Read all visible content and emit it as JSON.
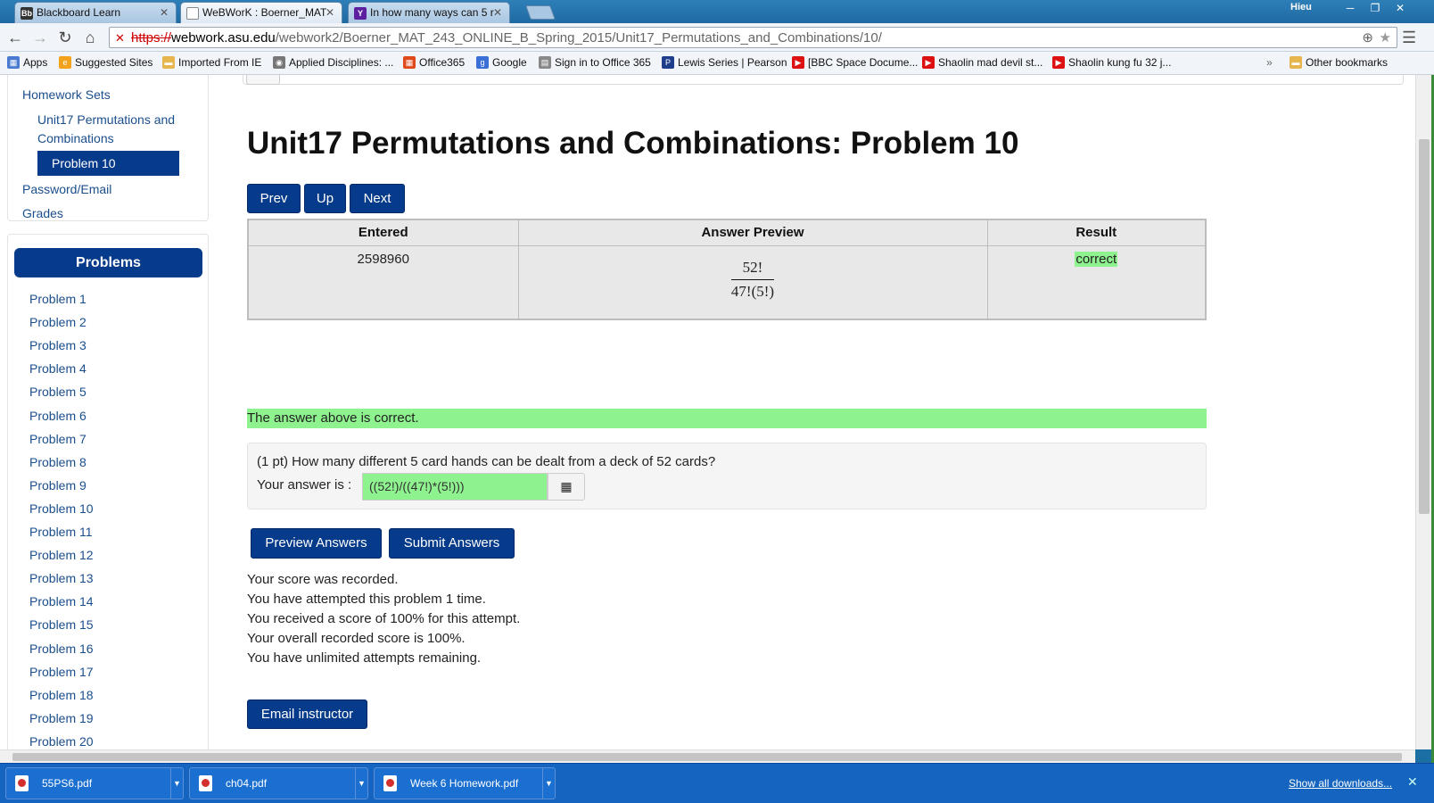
{
  "browser": {
    "tabs": [
      {
        "label": "Blackboard Learn",
        "icon": "Bb"
      },
      {
        "label": "WeBWorK : Boerner_MAT",
        "icon": "doc"
      },
      {
        "label": "In how many ways can 5 r",
        "icon": "Y"
      }
    ],
    "user": "Hieu",
    "url_scheme": "https://",
    "url_host": "webwork.asu.edu",
    "url_path": "/webwork2/Boerner_MAT_243_ONLINE_B_Spring_2015/Unit17_Permutations_and_Combinations/10/",
    "bookmarks": [
      "Apps",
      "Suggested Sites",
      "Imported From IE",
      "Applied Disciplines: ...",
      "Office365",
      "Google",
      "Sign in to Office 365",
      "Lewis Series | Pearson",
      "[BBC Space Docume...",
      "Shaolin mad devil st...",
      "Shaolin kung fu 32 j..."
    ],
    "other_bookmarks": "Other bookmarks"
  },
  "sidebar": {
    "homework_sets": "Homework Sets",
    "set_name_line1": "Unit17 Permutations and",
    "set_name_line2": "Combinations",
    "current_problem": "Problem 10",
    "password_email": "Password/Email",
    "grades": "Grades",
    "problems_header": "Problems",
    "problems": [
      "Problem 1",
      "Problem 2",
      "Problem 3",
      "Problem 4",
      "Problem 5",
      "Problem 6",
      "Problem 7",
      "Problem 8",
      "Problem 9",
      "Problem 10",
      "Problem 11",
      "Problem 12",
      "Problem 13",
      "Problem 14",
      "Problem 15",
      "Problem 16",
      "Problem 17",
      "Problem 18",
      "Problem 19",
      "Problem 20"
    ]
  },
  "main": {
    "title": "Unit17 Permutations and Combinations: Problem 10",
    "nav": {
      "prev": "Prev",
      "up": "Up",
      "next": "Next"
    },
    "results_table": {
      "headers": [
        "Entered",
        "Answer Preview",
        "Result"
      ],
      "entered": "2598960",
      "preview_numerator": "52!",
      "preview_denominator": "47!(5!)",
      "result": "correct"
    },
    "message": "The answer above is correct.",
    "question": "(1 pt) How many different 5 card hands can be dealt from a deck of 52 cards?",
    "answer_label": "Your answer is :",
    "answer_value": "((52!)/((47!)*(5!)))",
    "preview_button": "Preview Answers",
    "submit_button": "Submit Answers",
    "status_lines": [
      "Your score was recorded.",
      "You have attempted this problem 1 time.",
      "You received a score of 100% for this attempt.",
      "Your overall recorded score is 100%.",
      "You have unlimited attempts remaining."
    ],
    "email_button": "Email instructor"
  },
  "downloads": {
    "items": [
      "55PS6.pdf",
      "ch04.pdf",
      "Week 6 Homework.pdf"
    ],
    "show_all": "Show all downloads..."
  },
  "colors": {
    "accent": "#063a8a",
    "correct_green": "#8ef28e",
    "download_bar": "#1565c0"
  }
}
